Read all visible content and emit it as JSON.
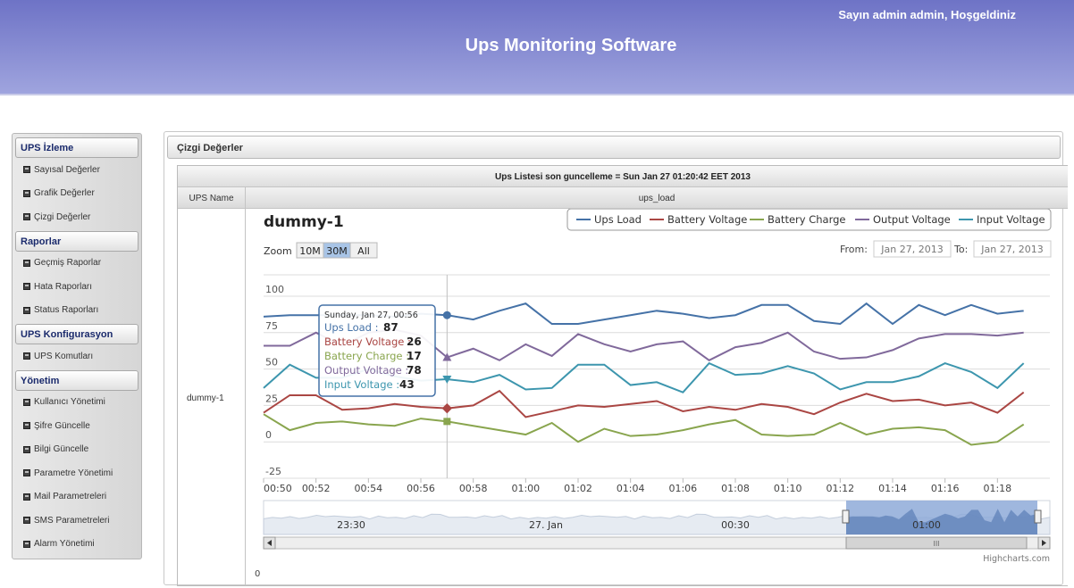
{
  "header": {
    "welcome": "Sayın admin admin, Hoşgeldiniz",
    "title": "Ups Monitoring Software"
  },
  "sidebar": {
    "sections": [
      {
        "title": "UPS İzleme",
        "items": [
          "Sayısal Değerler",
          "Grafik Değerler",
          "Çizgi Değerler"
        ]
      },
      {
        "title": "Raporlar",
        "items": [
          "Geçmiş Raporlar",
          "Hata Raporları",
          "Status Raporları"
        ]
      },
      {
        "title": "UPS Konfigurasyon",
        "items": [
          "UPS Komutları"
        ]
      },
      {
        "title": "Yönetim",
        "items": [
          "Kullanıcı Yönetimi",
          "Şifre Güncelle",
          "Bilgi Güncelle",
          "Parametre Yönetimi",
          "Mail Parametreleri",
          "SMS Parametreleri",
          "Alarm Yönetimi"
        ]
      }
    ]
  },
  "panel": {
    "title": "Çizgi Değerler",
    "table_caption": "Ups Listesi son guncelleme = Sun Jan 27 01:20:42 EET 2013",
    "col_name": "UPS Name",
    "col_value": "ups_load",
    "row_name": "dummy-1"
  },
  "chart_data": {
    "type": "line",
    "title": "dummy-1",
    "zoom_label": "Zoom",
    "zoom_buttons": [
      "10M",
      "30M",
      "All"
    ],
    "zoom_selected": "30M",
    "from_label": "From:",
    "to_label": "To:",
    "from_date": "Jan 27, 2013",
    "to_date": "Jan 27, 2013",
    "legend_position": "top-right",
    "credits": "Highcharts.com",
    "ylim": [
      -25,
      100
    ],
    "y_ticks": [
      "100",
      "75",
      "50",
      "25",
      "0",
      "-25"
    ],
    "x_ticks": [
      "00:50",
      "00:52",
      "00:54",
      "00:56",
      "00:58",
      "01:00",
      "01:02",
      "01:04",
      "01:06",
      "01:08",
      "01:10",
      "01:12",
      "01:14",
      "01:16",
      "01:18"
    ],
    "x_range_minutes": [
      0,
      30
    ],
    "series": [
      {
        "name": "Ups Load",
        "color": "#4572a7",
        "values": [
          86,
          87,
          87,
          87,
          87,
          86,
          88,
          87,
          84,
          90,
          95,
          81,
          81,
          84,
          87,
          90,
          88,
          85,
          87,
          94,
          94,
          83,
          81,
          95,
          81,
          94,
          87,
          94,
          88,
          90
        ]
      },
      {
        "name": "Battery Voltage",
        "color": "#aa4643",
        "values": [
          20,
          32,
          32,
          22,
          23,
          26,
          24,
          23,
          25,
          35,
          17,
          21,
          25,
          24,
          26,
          28,
          21,
          24,
          22,
          26,
          24,
          19,
          27,
          33,
          28,
          29,
          25,
          27,
          20,
          34
        ]
      },
      {
        "name": "Battery Charge",
        "color": "#89a54e",
        "values": [
          19,
          8,
          13,
          14,
          12,
          11,
          16,
          14,
          11,
          8,
          5,
          13,
          0,
          9,
          4,
          5,
          8,
          12,
          15,
          5,
          4,
          5,
          13,
          5,
          9,
          10,
          8,
          -2,
          0,
          12
        ]
      },
      {
        "name": "Output Voltage",
        "color": "#80699b",
        "values": [
          66,
          66,
          75,
          66,
          75,
          77,
          73,
          58,
          64,
          56,
          67,
          59,
          74,
          67,
          62,
          67,
          69,
          56,
          65,
          68,
          75,
          62,
          57,
          58,
          63,
          71,
          74,
          74,
          73,
          75
        ]
      },
      {
        "name": "Input Voltage",
        "color": "#3d96ae",
        "values": [
          37,
          53,
          44,
          44,
          50,
          45,
          42,
          43,
          41,
          46,
          36,
          37,
          53,
          53,
          39,
          41,
          34,
          54,
          46,
          47,
          52,
          47,
          36,
          41,
          41,
          45,
          54,
          48,
          37,
          54
        ]
      }
    ],
    "tooltip": {
      "date": "Sunday, Jan 27, 00:56",
      "x_index": 7,
      "rows": [
        {
          "label": "Ups Load",
          "value": 87
        },
        {
          "label": "Battery Voltage",
          "value": 26
        },
        {
          "label": "Battery Charge",
          "value": 17
        },
        {
          "label": "Output Voltage",
          "value": 78
        },
        {
          "label": "Input Voltage",
          "value": 43
        }
      ]
    },
    "navigator": {
      "labels": [
        "23:30",
        "27. Jan",
        "00:30",
        "01:00"
      ],
      "handle_grip": "III",
      "bottom_label": "0"
    }
  }
}
